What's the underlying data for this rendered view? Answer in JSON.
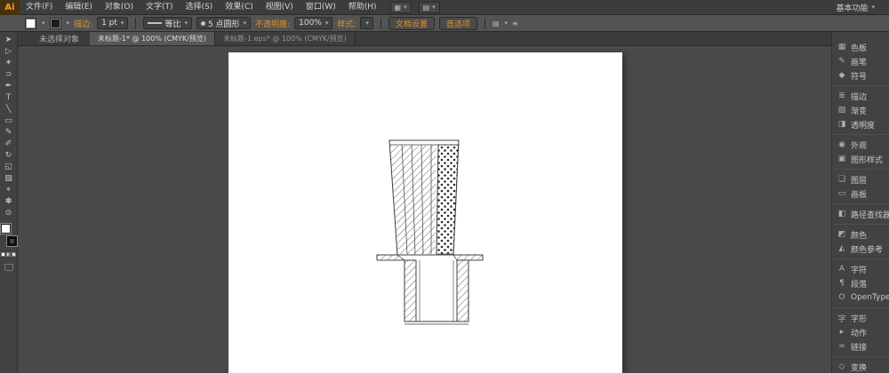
{
  "ui": {
    "caret": "▾",
    "accent_orange": "#e0922f",
    "panel_gray": "#424242",
    "canvas_gray": "#4a4a4a"
  },
  "app_bar": {
    "logo": "Ai",
    "menus": [
      {
        "label": "文件(F)"
      },
      {
        "label": "编辑(E)"
      },
      {
        "label": "对象(O)"
      },
      {
        "label": "文字(T)"
      },
      {
        "label": "选择(S)"
      },
      {
        "label": "效果(C)"
      },
      {
        "label": "视图(V)"
      },
      {
        "label": "窗口(W)"
      },
      {
        "label": "帮助(H)"
      }
    ],
    "arrange_icon": "▦",
    "screen_mode_icon": "▤",
    "workspace_label": "基本功能"
  },
  "control_bar": {
    "fill_color": "#ffffff",
    "stroke_color": "#1c1c1c",
    "stroke_label": "描边:",
    "stroke_width": "1 pt",
    "profile_label": "等比",
    "brush_name": "5 点圆形",
    "opacity_label": "不透明度:",
    "opacity_value": "100%",
    "style_label": "样式:",
    "document_setup_label": "文档设置",
    "preferences_label": "首选项",
    "align_icon": "▤",
    "menu_icon": "≡"
  },
  "document": {
    "status": "未选择对象",
    "tabs": [
      {
        "label": "未标题-1* @ 100% (CMYK/预览)",
        "active": true
      },
      {
        "label": "未标题-1.eps* @ 100% (CMYK/预览)",
        "active": false
      }
    ]
  },
  "toolbar": {
    "fill_color": "#ffffff",
    "stroke_color": "#000000",
    "tools": [
      {
        "name": "selection-tool",
        "glyph": "➤"
      },
      {
        "name": "direct-selection-tool",
        "glyph": "▷"
      },
      {
        "name": "magic-wand-tool",
        "glyph": "✶"
      },
      {
        "name": "lasso-tool",
        "glyph": "⊃"
      },
      {
        "name": "pen-tool",
        "glyph": "✒"
      },
      {
        "name": "type-tool",
        "glyph": "T"
      },
      {
        "name": "line-segment-tool",
        "glyph": "╲"
      },
      {
        "name": "rectangle-tool",
        "glyph": "▭"
      },
      {
        "name": "paintbrush-tool",
        "glyph": "✎"
      },
      {
        "name": "pencil-tool",
        "glyph": "✐"
      },
      {
        "name": "rotate-tool",
        "glyph": "↻"
      },
      {
        "name": "scale-tool",
        "glyph": "◱"
      },
      {
        "name": "gradient-tool",
        "glyph": "▧"
      },
      {
        "name": "eyedropper-tool",
        "glyph": "⌖"
      },
      {
        "name": "hand-tool",
        "glyph": "✽"
      },
      {
        "name": "zoom-tool",
        "glyph": "⊙"
      }
    ]
  },
  "right_dock": {
    "groups": [
      {
        "items": [
          {
            "label": "色板",
            "icon": "swatches-icon",
            "glyph": "▦"
          },
          {
            "label": "画笔",
            "icon": "brushes-icon",
            "glyph": "✎"
          },
          {
            "label": "符号",
            "icon": "symbols-icon",
            "glyph": "◆"
          }
        ]
      },
      {
        "items": [
          {
            "label": "描边",
            "icon": "stroke-icon",
            "glyph": "≣"
          },
          {
            "label": "渐变",
            "icon": "gradient-icon",
            "glyph": "▧"
          },
          {
            "label": "透明度",
            "icon": "transparency-icon",
            "glyph": "◨"
          }
        ]
      },
      {
        "items": [
          {
            "label": "外观",
            "icon": "appearance-icon",
            "glyph": "◉"
          },
          {
            "label": "图形样式",
            "icon": "graphic-styles-icon",
            "glyph": "▣"
          }
        ]
      },
      {
        "items": [
          {
            "label": "图层",
            "icon": "layers-icon",
            "glyph": "❏"
          },
          {
            "label": "画板",
            "icon": "artboards-icon",
            "glyph": "▭"
          }
        ]
      },
      {
        "items": [
          {
            "label": "路径查找器",
            "icon": "pathfinder-icon",
            "glyph": "◧"
          }
        ]
      },
      {
        "items": [
          {
            "label": "颜色",
            "icon": "color-icon",
            "glyph": "◩"
          },
          {
            "label": "颜色参考",
            "icon": "color-guide-icon",
            "glyph": "◭"
          }
        ]
      },
      {
        "items": [
          {
            "label": "字符",
            "icon": "character-icon",
            "glyph": "A"
          },
          {
            "label": "段落",
            "icon": "paragraph-icon",
            "glyph": "¶"
          },
          {
            "label": "OpenType",
            "icon": "opentype-icon",
            "glyph": "O"
          }
        ]
      },
      {
        "items": [
          {
            "label": "字形",
            "icon": "glyphs-icon",
            "glyph": "字"
          },
          {
            "label": "动作",
            "icon": "actions-icon",
            "glyph": "▸"
          },
          {
            "label": "链接",
            "icon": "links-icon",
            "glyph": "∞"
          }
        ]
      },
      {
        "items": [
          {
            "label": "变换",
            "icon": "transform-icon",
            "glyph": "◇"
          }
        ]
      }
    ]
  }
}
